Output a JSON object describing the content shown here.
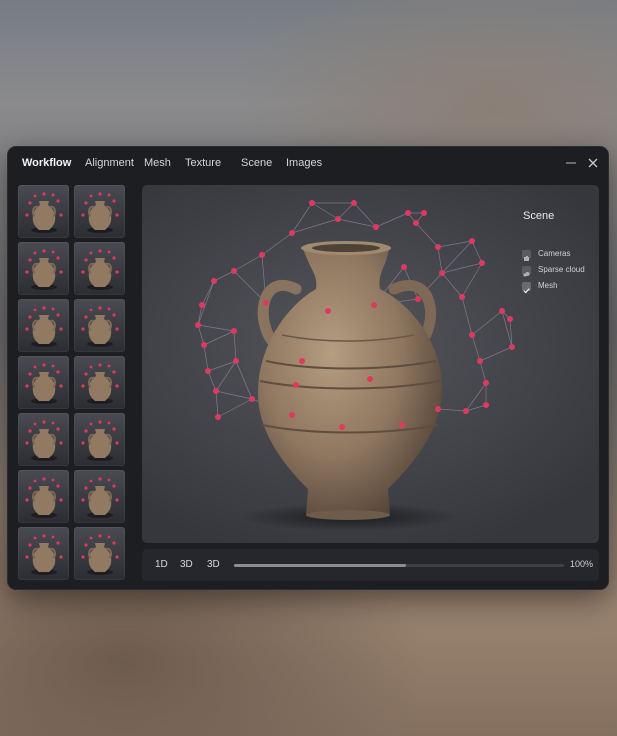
{
  "menu": {
    "items": [
      {
        "label": "Workflow",
        "active": true
      },
      {
        "label": "Alignment"
      },
      {
        "label": "Mesh"
      },
      {
        "label": "Texture"
      },
      {
        "label": "Scene"
      },
      {
        "label": "Images"
      }
    ]
  },
  "window_controls": {
    "minimize_icon": "minimize-icon",
    "close_icon": "close-icon"
  },
  "sidebar": {
    "thumbnail_count": 14,
    "thumbnail_icon": "vase-thumbnail"
  },
  "scene_panel": {
    "title": "Scene",
    "items": [
      {
        "label": "Cameras",
        "icon": "camera-icon",
        "checked": false
      },
      {
        "label": "Sparse cloud",
        "icon": "cloud-icon",
        "checked": false
      },
      {
        "label": "Mesh",
        "icon": "check-icon",
        "checked": true
      }
    ]
  },
  "bottom_bar": {
    "view_buttons": [
      "1D",
      "3D",
      "3D"
    ],
    "progress": 0.52,
    "progress_label": "100%"
  },
  "colors": {
    "point": "#e0395f",
    "accent": "#8d8e95"
  }
}
